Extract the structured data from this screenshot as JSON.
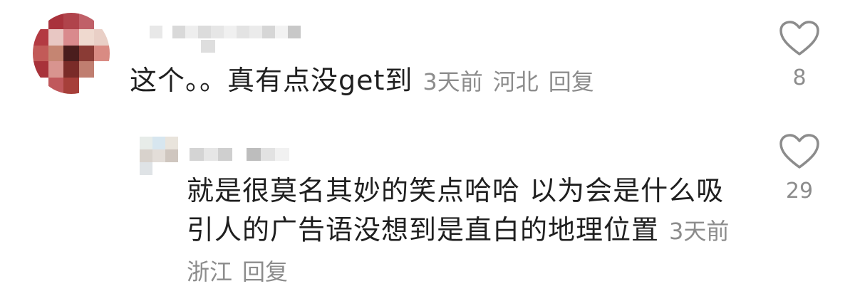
{
  "comments": [
    {
      "text": "这个。。真有点没get到",
      "time": "3天前",
      "location": "河北",
      "reply_label": "回复",
      "likes": "8",
      "icon": "heart-outline-icon"
    },
    {
      "text": "就是很莫名其妙的笑点哈哈 以为会是什么吸引人的广告语没想到是直白的地理位置",
      "time": "3天前",
      "location": "浙江",
      "reply_label": "回复",
      "likes": "29",
      "icon": "heart-outline-icon"
    }
  ],
  "colors": {
    "text": "#1f1f1f",
    "meta": "#8c8c8c",
    "icon": "#8c8c8c"
  }
}
